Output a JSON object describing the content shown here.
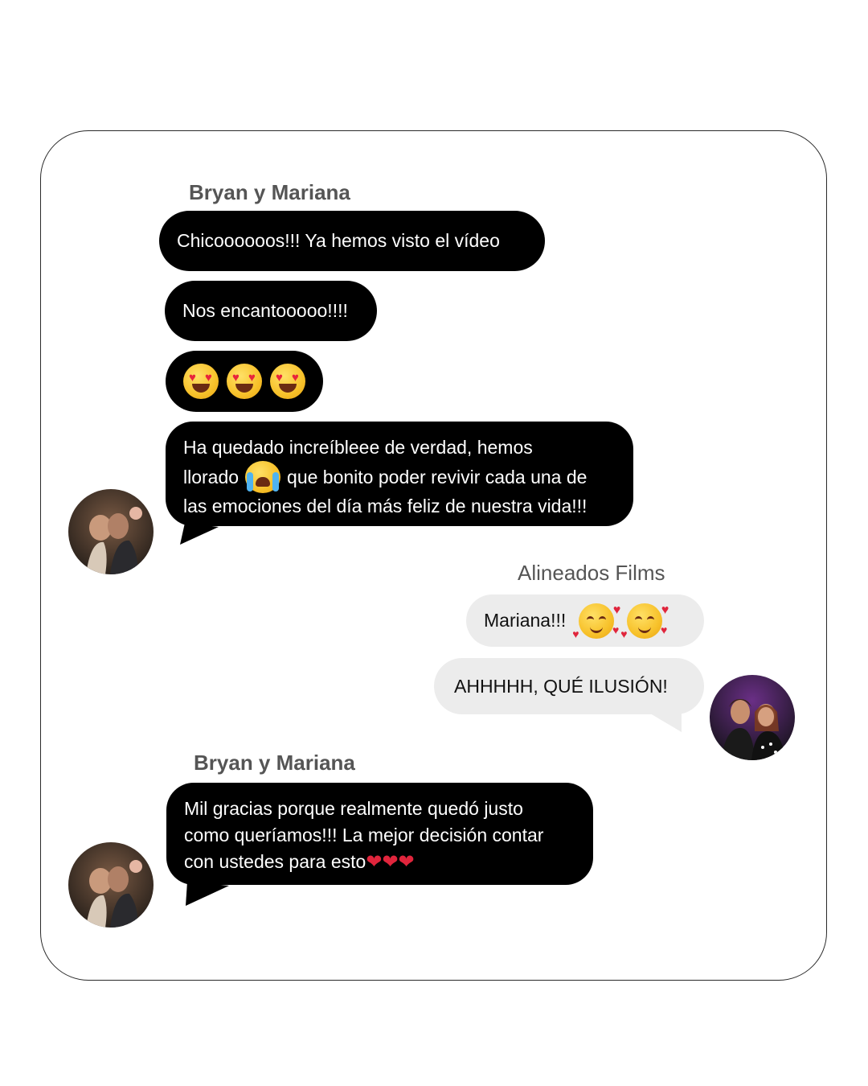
{
  "conversation": {
    "group1": {
      "sender": "Bryan y Mariana",
      "messages": [
        "Chicoooooos!!! Ya hemos visto el vídeo",
        "Nos encantooooo!!!!"
      ],
      "emoji_message": [
        "heart-eyes",
        "heart-eyes",
        "heart-eyes"
      ],
      "long_message": {
        "line1": "Ha quedado increíbleee de verdad, hemos",
        "line2_before": "llorado",
        "line2_emoji": "loudly-crying",
        "line2_after": "que bonito poder revivir cada una de",
        "line3": "las emociones del día más feliz de nuestra vida!!!"
      }
    },
    "group2": {
      "sender": "Alineados Films",
      "message1_text": "Mariana!!!",
      "message1_emojis": [
        "smiling-with-hearts",
        "smiling-with-hearts"
      ],
      "message2": "AHHHHH, QUÉ ILUSIÓN!"
    },
    "group3": {
      "sender": "Bryan y Mariana",
      "line1": "Mil gracias porque realmente quedó justo",
      "line2": "como queríamos!!! La mejor decisión contar",
      "line3": "con ustedes para esto",
      "hearts": "❤❤❤"
    }
  },
  "colors": {
    "client_bubble": "#000000",
    "studio_bubble": "#ececec",
    "name_text": "#555555",
    "heart": "#e0253c"
  }
}
